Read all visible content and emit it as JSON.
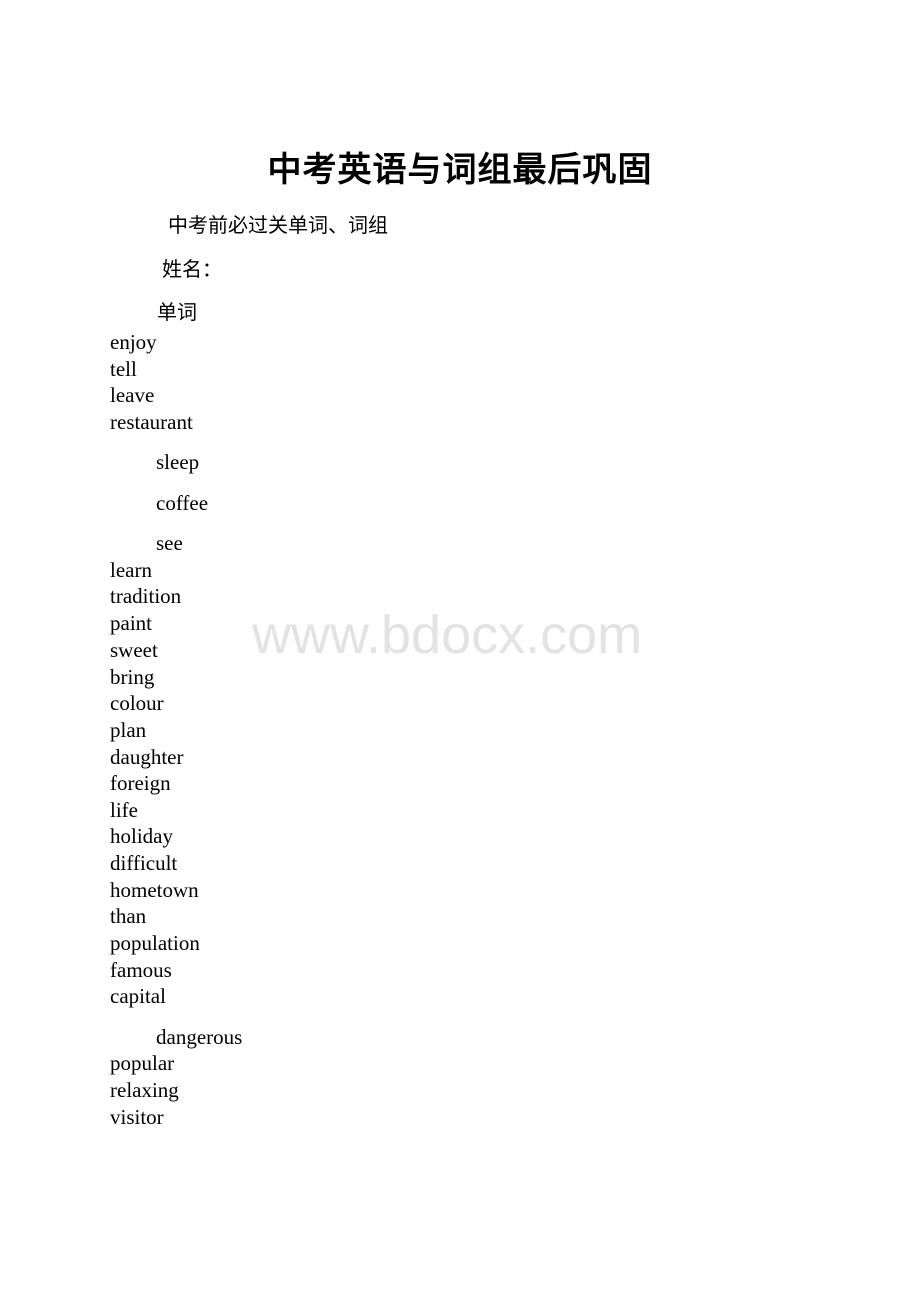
{
  "document": {
    "title": "中考英语与词组最后巩固",
    "subtitle": "中考前必过关单词、词组",
    "name_label": "姓名：",
    "section_label": "单词",
    "words": [
      {
        "text": "enjoy",
        "indent": false
      },
      {
        "text": "tell",
        "indent": false
      },
      {
        "text": "leave",
        "indent": false
      },
      {
        "text": "restaurant",
        "indent": false
      },
      {
        "text": "sleep",
        "indent": true
      },
      {
        "text": "coffee",
        "indent": true
      },
      {
        "text": "see",
        "indent": true
      },
      {
        "text": "learn",
        "indent": false
      },
      {
        "text": "tradition",
        "indent": false
      },
      {
        "text": "paint",
        "indent": false
      },
      {
        "text": "sweet",
        "indent": false
      },
      {
        "text": "bring",
        "indent": false
      },
      {
        "text": "colour",
        "indent": false
      },
      {
        "text": "plan",
        "indent": false
      },
      {
        "text": "daughter",
        "indent": false
      },
      {
        "text": "foreign",
        "indent": false
      },
      {
        "text": "life",
        "indent": false
      },
      {
        "text": "holiday",
        "indent": false
      },
      {
        "text": "difficult",
        "indent": false
      },
      {
        "text": "hometown",
        "indent": false
      },
      {
        "text": "than",
        "indent": false
      },
      {
        "text": "population",
        "indent": false
      },
      {
        "text": "famous",
        "indent": false
      },
      {
        "text": "capital",
        "indent": false
      },
      {
        "text": "dangerous",
        "indent": true
      },
      {
        "text": "popular",
        "indent": false
      },
      {
        "text": "relaxing",
        "indent": false
      },
      {
        "text": "visitor",
        "indent": false
      }
    ]
  },
  "watermark": {
    "text": "www.bdocx.com",
    "color": "#e3e3e3"
  }
}
